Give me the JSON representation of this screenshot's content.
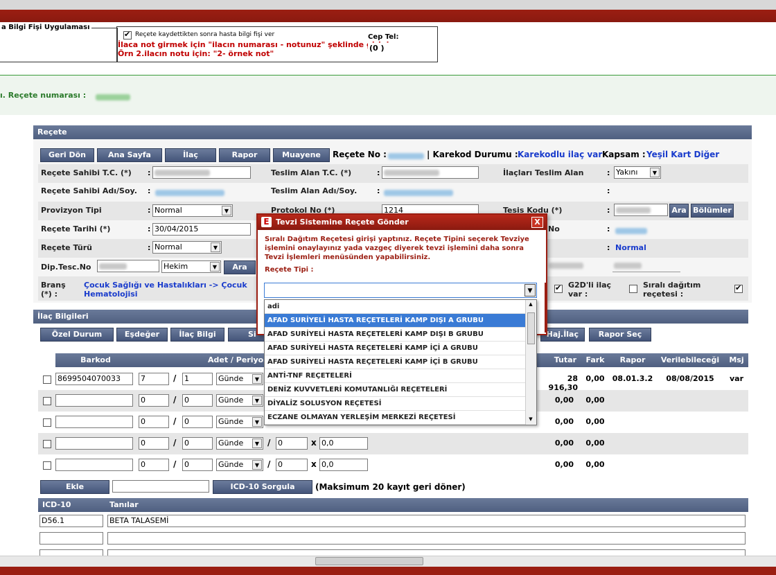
{
  "header": {
    "legend": "a Bilgi Fişi Uygulaması",
    "checkbox_label": "Reçete kaydettikten sonra hasta bilgi fişi ver",
    "note_line1": "İlaca not girmek için \"ilacın numarası - notunuz\" şeklinde giriniz",
    "note_line2": "Örn 2.ilacın notu için: \"2- örnek not\"",
    "phone_label": "Cep Tel:",
    "phone_value": "(0  )"
  },
  "banner": {
    "prescription_label": "ı. Reçete numarası :"
  },
  "recete": {
    "section_title": "Reçete",
    "buttons": [
      "Geri Dön",
      "Ana Sayfa",
      "İlaç",
      "Rapor",
      "Muayene"
    ],
    "recete_no_label": "Reçete No :",
    "karekod_label": "| Karekod Durumu :",
    "karekod_value": "Karekodlu ilaç var",
    "kapsam_label": "Kapsam :",
    "kapsam_value": "Yeşil Kart Diğer",
    "labels": {
      "sahibi_tc": "Reçete Sahibi T.C. (*)",
      "teslim_tc": "Teslim Alan T.C. (*)",
      "ilaclari_teslim": "İlaçları Teslim Alan",
      "sahibi_ad": "Reçete Sahibi Adı/Soy.",
      "teslim_ad": "Teslim Alan Adı/Soy.",
      "provizyon": "Provizyon Tipi",
      "protokol": "Protokol No (*)",
      "tesis": "Tesis Kodu (*)",
      "tarih": "Reçete Tarihi (*)",
      "no": "No",
      "turu": "Reçete Türü",
      "dip": "Dip.Tesc.No",
      "brans": "Branş (*) :",
      "g2d": "G2D'li ilaç var :",
      "sirali": "Sıralı dağıtım reçetesi :"
    },
    "teslim_alan_value": "Yakını",
    "provizyon_value": "Normal",
    "protokol_value": "1214",
    "tarih_value": "30/04/2015",
    "turu_value": "Normal",
    "tur_right_value": "Normal",
    "hekim_value": "Hekim",
    "ara": "Ara",
    "bolumler": "Bölümler",
    "brans_value": "Çocuk Sağlığı ve Hastalıkları -> Çocuk Hematolojisi",
    "colon": ":"
  },
  "ilac": {
    "section_title": "İlaç Bilgileri",
    "buttons": [
      "Özel Durum",
      "Eşdeğer",
      "İlaç Bilgi",
      "Si",
      "Haj.İlaç",
      "Rapor Seç"
    ],
    "columns": [
      "Barkod",
      "Adet / Periyo",
      "Tutar",
      "Fark",
      "Rapor",
      "Verilebileceği",
      "Msj"
    ],
    "rows": [
      {
        "barkod": "8699504070033",
        "adet": "7",
        "periyot": "1",
        "birim": "Günde",
        "doz": "",
        "doz2": "",
        "tutar": "28 916,30",
        "fark": "0,00",
        "rapor": "08.01.3.2",
        "verilebilecegi": "08/08/2015",
        "msj": "var"
      },
      {
        "barkod": "",
        "adet": "0",
        "periyot": "0",
        "birim": "Günde",
        "doz": "",
        "doz2": "",
        "tutar": "0,00",
        "fark": "0,00",
        "rapor": "",
        "verilebilecegi": "",
        "msj": ""
      },
      {
        "barkod": "",
        "adet": "0",
        "periyot": "0",
        "birim": "Günde",
        "doz": "",
        "doz2": "",
        "tutar": "0,00",
        "fark": "0,00",
        "rapor": "",
        "verilebilecegi": "",
        "msj": ""
      },
      {
        "barkod": "",
        "adet": "0",
        "periyot": "0",
        "birim": "Günde",
        "doz": "0",
        "doz2": "0,0",
        "tutar": "0,00",
        "fark": "0,00",
        "rapor": "",
        "verilebilecegi": "",
        "msj": ""
      },
      {
        "barkod": "",
        "adet": "0",
        "periyot": "0",
        "birim": "Günde",
        "doz": "0",
        "doz2": "0,0",
        "tutar": "0,00",
        "fark": "0,00",
        "rapor": "",
        "verilebilecegi": "",
        "msj": ""
      }
    ],
    "slash": "/",
    "times": "x",
    "ekle": "Ekle",
    "icd_sorgula": "ICD-10 Sorgula",
    "max_note": "(Maksimum 20 kayıt geri döner)"
  },
  "icd": {
    "columns": [
      "ICD-10",
      "Tanılar"
    ],
    "rows": [
      {
        "code": "D56.1",
        "tani": "BETA TALASEMİ"
      },
      {
        "code": "",
        "tani": ""
      },
      {
        "code": "",
        "tani": ""
      }
    ]
  },
  "dialog": {
    "title": "Tevzi Sistemine Reçete Gönder",
    "logo": "E",
    "close": "X",
    "message": "Sıralı Dağıtım Reçetesi girişi yaptınız. Reçete Tipini seçerek Tevziye işlemini onaylayınız yada vazgeç diyerek tevzi işlemini daha sonra Tevzi İşlemleri menüsünden yapabilirsiniz.",
    "field_label": "Reçete Tipi :",
    "field_value": "",
    "options": [
      "adi",
      "AFAD SURİYELİ HASTA REÇETELERİ KAMP DIŞI A GRUBU",
      "AFAD SURİYELİ HASTA REÇETELERİ KAMP DIŞI B GRUBU",
      "AFAD SURİYELİ HASTA REÇETELERİ KAMP İÇİ A GRUBU",
      "AFAD SURİYELİ HASTA REÇETELERİ KAMP İÇİ B GRUBU",
      "ANTİ-TNF REÇETELERİ",
      "DENİZ KUVVETLERİ KOMUTANLIĞI REÇETELERİ",
      "DİYALİZ SOLUSYON REÇETESİ",
      "ECZANE OLMAYAN YERLEŞİM MERKEZİ REÇETESİ"
    ],
    "highlighted_index": 1
  }
}
